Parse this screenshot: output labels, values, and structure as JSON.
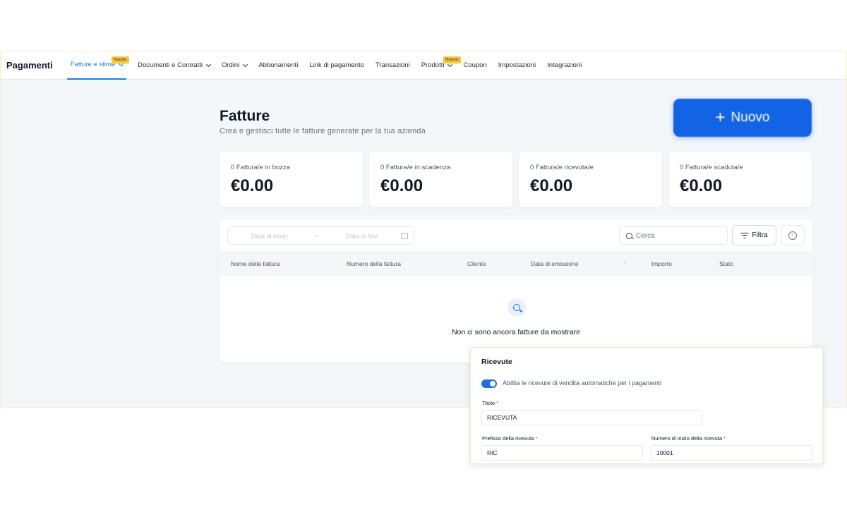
{
  "nav": {
    "brand": "Pagamenti",
    "items": [
      {
        "label": "Fatture e stime",
        "badge": "Nuovo",
        "dropdown": true,
        "active": true
      },
      {
        "label": "Documenti e Contratti",
        "dropdown": true
      },
      {
        "label": "Ordini",
        "dropdown": true
      },
      {
        "label": "Abbonamenti"
      },
      {
        "label": "Link di pagamento"
      },
      {
        "label": "Transazioni"
      },
      {
        "label": "Prodotti",
        "badge": "Nuovo",
        "dropdown": true
      },
      {
        "label": "Coupon"
      },
      {
        "label": "Impostazioni"
      },
      {
        "label": "Integrazioni"
      }
    ]
  },
  "header": {
    "title": "Fatture",
    "subtitle": "Crea e gestisci tutte le fatture generate per la tua azienda",
    "new_button": "Nuovo",
    "new_button_icon": "plus-icon"
  },
  "stats": [
    {
      "label": "0 Fattura/e in bozza",
      "value": "€0.00"
    },
    {
      "label": "0 Fattura/e in scadenza",
      "value": "€0.00"
    },
    {
      "label": "0 Fattura/e ricevuta/e",
      "value": "€0.00"
    },
    {
      "label": "0 Fattura/e scaduta/e",
      "value": "€0.00"
    }
  ],
  "toolbar": {
    "date_start_placeholder": "Data di inizio",
    "date_end_placeholder": "Data di fine",
    "search_placeholder": "Cerca",
    "filter_label": "Filtra"
  },
  "table": {
    "columns": [
      "Nome della fattura",
      "Numero della fattura",
      "Cliente",
      "Data di emissione",
      "Importo",
      "Stato"
    ],
    "empty_message": "Non ci sono ancora fatture da mostrare"
  },
  "receipts": {
    "title": "Ricevute",
    "toggle_label": "Abilita le ricevute di vendita automatiche per i pagamenti",
    "toggle_on": true,
    "title_field_label": "Titolo",
    "title_field_value": "RICEVUTA",
    "prefix_label": "Prefisso della ricevuta",
    "prefix_value": "RIC",
    "start_number_label": "Numero di inizio della ricevuta",
    "start_number_value": "10001",
    "required_mark": "*"
  },
  "colors": {
    "accent": "#1d7fd6",
    "primary_button": "#1363e6",
    "badge": "#f5c542",
    "page_bg": "#f4f7f9"
  }
}
